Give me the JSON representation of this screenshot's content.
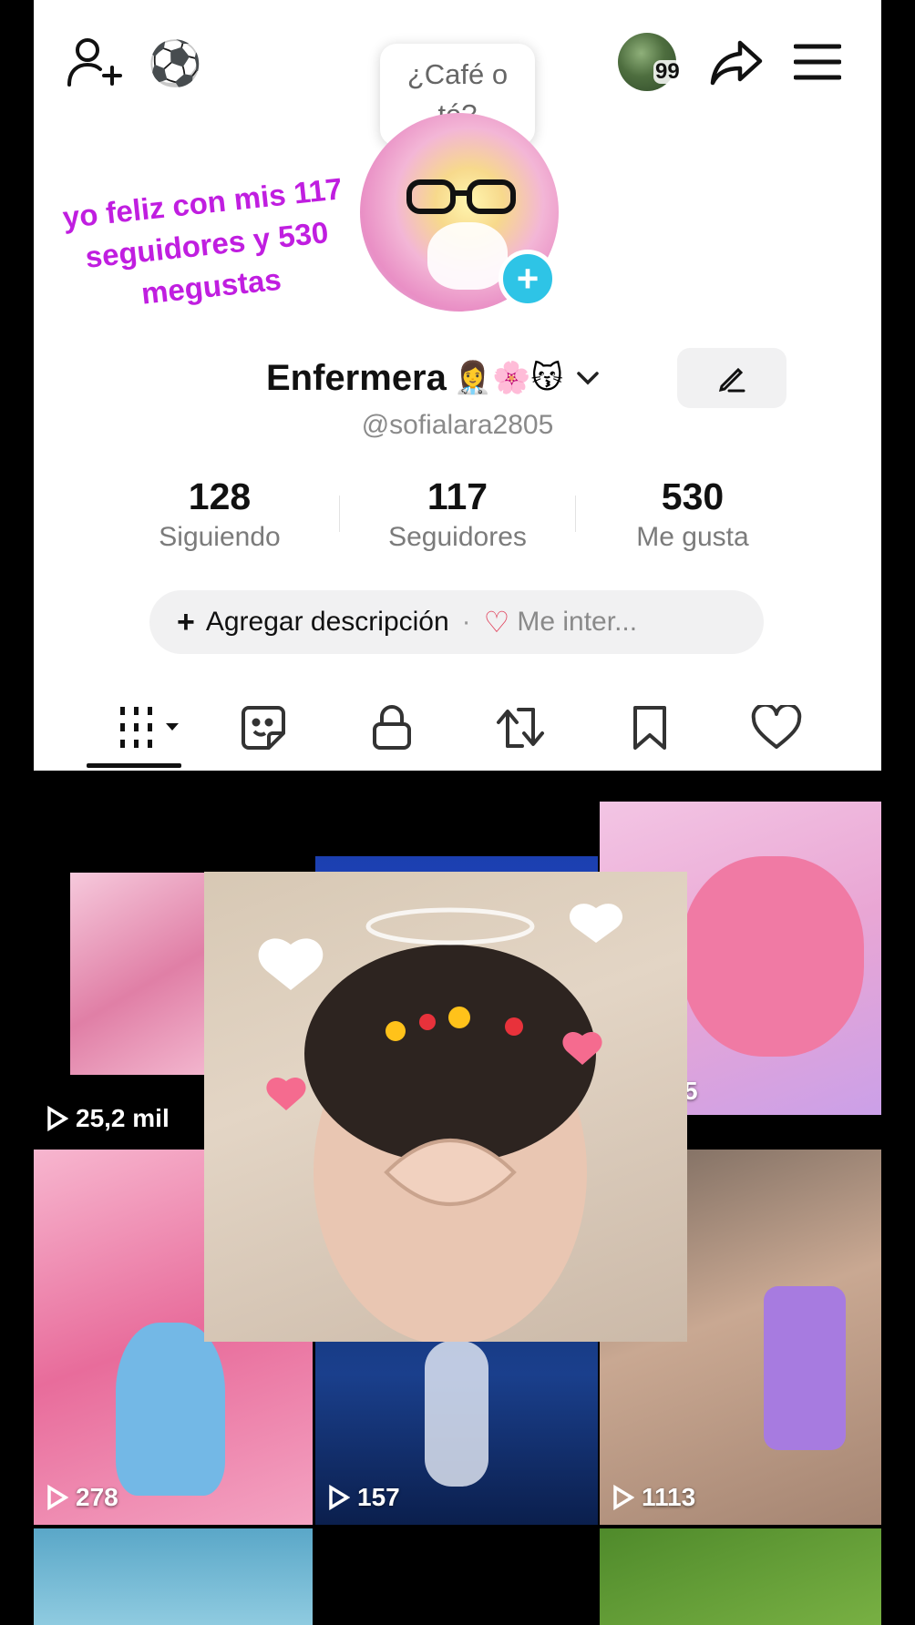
{
  "header": {
    "visitor_badge": "99",
    "status_bubble": "¿Café o té?"
  },
  "overlay_caption": "yo feliz con mis 117 seguidores y 530 megustas",
  "profile": {
    "display_name": "Enfermera",
    "name_emojis": "👩‍⚕️🌸😽",
    "username": "@sofialara2805"
  },
  "stats": [
    {
      "value": "128",
      "label": "Siguiendo"
    },
    {
      "value": "117",
      "label": "Seguidores"
    },
    {
      "value": "530",
      "label": "Me gusta"
    }
  ],
  "description_bar": {
    "add_label": "Agregar descripción",
    "separator": "·",
    "interests_label": "Me inter..."
  },
  "tabs": [
    "videos",
    "stickers",
    "private",
    "reposts",
    "saved",
    "liked"
  ],
  "videos": [
    {
      "views": "25,2 mil"
    },
    {
      "views": ""
    },
    {
      "views": "5"
    },
    {
      "views": "278"
    },
    {
      "views": "157"
    },
    {
      "views": "1113"
    }
  ],
  "colors": {
    "overlay_caption": "#c01ee0",
    "plus_badge": "#2ec4e6",
    "heart": "#e0405a"
  }
}
